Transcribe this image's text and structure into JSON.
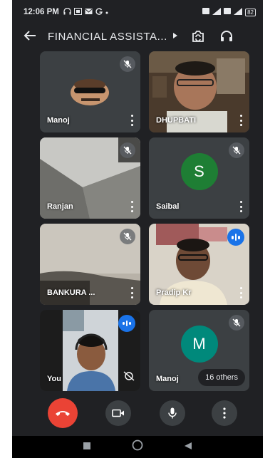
{
  "status_bar": {
    "time": "12:06 PM",
    "left_glyphs": [
      "headset-icon",
      "sim-icon",
      "message-icon",
      "google-icon"
    ],
    "battery": "82"
  },
  "app_bar": {
    "title": "FINANCIAL ASSISTA...",
    "back_icon": "arrow-back-icon",
    "camera_switch_icon": "switch-camera-icon",
    "audio_icon": "headphones-icon"
  },
  "participants": [
    {
      "name": "Manoj",
      "muted": true
    },
    {
      "name": "DHUPBATI",
      "muted": false
    },
    {
      "name": "Ranjan",
      "muted": true
    },
    {
      "name": "Saibal",
      "muted": true,
      "avatar_letter": "S",
      "avatar_color": "#1e7e34"
    },
    {
      "name": "BANKURA ...",
      "muted": true
    },
    {
      "name": "Pradip Kr",
      "speaking": true
    },
    {
      "name": "You",
      "speaking": true
    },
    {
      "name": "Manoj",
      "muted": true,
      "avatar_letter": "M",
      "avatar_color": "#00897b",
      "others_label": "16 others"
    }
  ],
  "controls": [
    "end-call-icon",
    "camera-icon",
    "microphone-icon",
    "more-options-icon"
  ],
  "colors": {
    "background": "#202124",
    "tile": "#3c4043",
    "end_call": "#ea4335",
    "speaking": "#1a73e8"
  }
}
